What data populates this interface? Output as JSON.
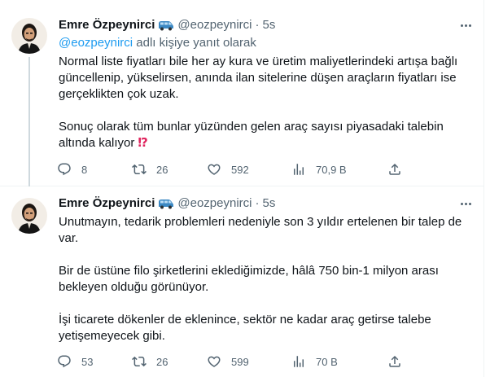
{
  "tweets": [
    {
      "author_name": "Emre Özpeynirci",
      "handle": "@eozpeynirci",
      "separator": "·",
      "time": "5s",
      "reply_prefix_mention": "@eozpeynirci",
      "reply_suffix": "adlı kişiye yanıt olarak",
      "paragraphs": [
        "Normal liste fiyatları bile her ay kura ve üretim maliyetlerindeki artışa bağlı güncellenip, yükselirsen, anında ilan sitelerine düşen araçların fiyatları ise gerçeklikten çok uzak.",
        "Sonuç olarak tüm bunlar yüzünden gelen araç sayısı piyasadaki talebin altında kalıyor"
      ],
      "emoji": "⁉",
      "stats": {
        "replies": "8",
        "retweets": "26",
        "likes": "592",
        "views": "70,9 B"
      }
    },
    {
      "author_name": "Emre Özpeynirci",
      "handle": "@eozpeynirci",
      "separator": "·",
      "time": "5s",
      "paragraphs": [
        "Unutmayın, tedarik problemleri nedeniyle son 3 yıldır ertelenen bir talep de var.",
        "Bir de üstüne filo şirketlerini eklediğimizde, hâlâ 750 bin-1 milyon arası bekleyen olduğu görünüyor.",
        "İşi ticarete dökenler de eklenince, sektör ne kadar araç getirse talebe yetişemeyecek gibi."
      ],
      "stats": {
        "replies": "53",
        "retweets": "26",
        "likes": "599",
        "views": "70 B"
      }
    }
  ],
  "icons": {
    "reply": "reply-icon",
    "retweet": "retweet-icon",
    "like": "heart-icon",
    "views": "views-icon",
    "share": "share-icon",
    "badge": "van-emoji-icon"
  },
  "colors": {
    "text": "#0f1419",
    "secondary": "#536471",
    "link": "#1d9bf0",
    "divider": "#eff3f4",
    "thread_line": "#cfd9de"
  }
}
